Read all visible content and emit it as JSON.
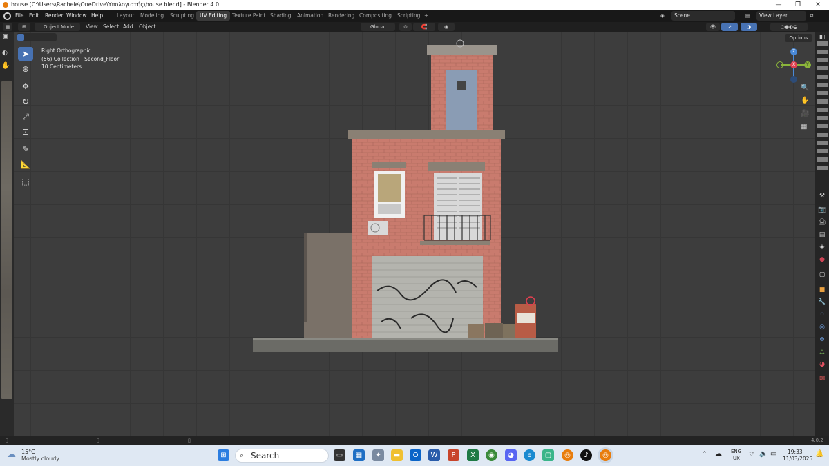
{
  "title_bar": {
    "title": "house [C:\\Users\\Rachele\\OneDrive\\Υπολογιστής\\house.blend] - Blender 4.0",
    "minimize": "—",
    "maximize": "❐",
    "close": "✕"
  },
  "menu": [
    "File",
    "Edit",
    "Render",
    "Window",
    "Help"
  ],
  "workspaces": {
    "tabs": [
      "Layout",
      "Modeling",
      "Sculpting",
      "UV Editing",
      "Texture Paint",
      "Shading",
      "Animation",
      "Rendering",
      "Compositing",
      "Scripting"
    ],
    "active": "UV Editing",
    "add": "+"
  },
  "scene": {
    "label": "Scene",
    "view_layer": "View Layer"
  },
  "viewport_header": {
    "mode": "Object Mode",
    "menus": [
      "View",
      "Select",
      "Add",
      "Object"
    ],
    "orientation": "Global",
    "options": "Options"
  },
  "viewport_info": {
    "view": "Right Orthographic",
    "collection": "(56) Collection | Second_Floor",
    "scale": "10 Centimeters"
  },
  "gizmo": {
    "z": "Z",
    "y": "Y",
    "x": "X"
  },
  "status_bar": {
    "version": "4.0.2"
  },
  "taskbar": {
    "weather_temp": "15°C",
    "weather_desc": "Mostly cloudy",
    "search": "Search",
    "lang": "ENG",
    "region": "UK",
    "time": "19:33",
    "date": "11/03/2025"
  },
  "colors": {
    "accent": "#4772b3",
    "active_tab": "#3a3a3a",
    "viewport_bg": "#3d3d3d",
    "x_axis": "#8bb53b",
    "y_axis": "#4a8ad8",
    "brick": "#c97b6e"
  }
}
